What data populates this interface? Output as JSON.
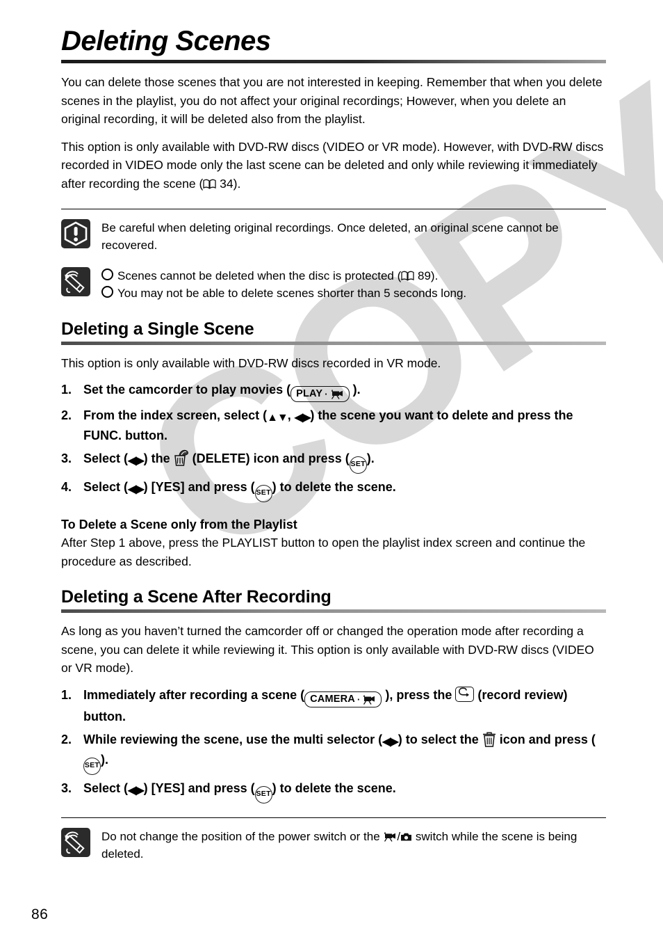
{
  "watermark": {
    "text": "COPY"
  },
  "page": {
    "title": "Deleting Scenes",
    "number": "86"
  },
  "intro": {
    "paragraph_1": "You can delete those scenes that you are not interested in keeping. Remember that when you delete scenes in the playlist, you do not affect your original recordings; However, when you delete an original recording, it will be deleted also from the playlist.",
    "paragraph_2_a": "This option is only available with DVD-RW discs (VIDEO or VR mode). However, with DVD-RW discs recorded in VIDEO mode only the last scene can be deleted and only while reviewing it immediately after recording the scene (",
    "paragraph_2_ref": "34",
    "paragraph_2_b": ")."
  },
  "callouts": {
    "warning": {
      "icon": "warning-exclamation-icon",
      "text": "Be careful when deleting original recordings. Once deleted, an original scene cannot be recovered."
    },
    "notes": {
      "icon": "note-pencil-icon",
      "bullet_1_a": "Scenes cannot be deleted when the disc is protected (",
      "bullet_1_ref": "89",
      "bullet_1_b": ").",
      "bullet_2": "You may not be able to delete scenes shorter than 5 seconds long."
    },
    "footer_note": {
      "icon": "note-pencil-icon",
      "text_a": "Do not change the position of the power switch or the",
      "text_b": "/",
      "text_c": "switch while the scene is being deleted."
    }
  },
  "section_single": {
    "heading": "Deleting a Single Scene",
    "intro": "This option is only available with DVD-RW discs recorded in VR mode.",
    "steps": [
      {
        "num": "1.",
        "text_a": "Set the camcorder to play movies (",
        "badge": "PLAY",
        "text_b": ")."
      },
      {
        "num": "2.",
        "text_a": "From the index screen, select (",
        "arrows_1": "▲▼",
        "text_mid": ",",
        "arrows_2": "◀▶",
        "text_b": ") the scene you want to delete and press the FUNC. button."
      },
      {
        "num": "3.",
        "text_a": "Select (",
        "arrows_1": "◀▶",
        "text_b": ") the",
        "icon": "delete-trash-icon",
        "text_c": "(DELETE) icon and press (",
        "set_label": "SET",
        "text_d": ")."
      },
      {
        "num": "4.",
        "text_a": "Select (",
        "arrows_1": "◀▶",
        "text_b": ") [YES] and press (",
        "set_label": "SET",
        "text_c": ") to delete the scene."
      }
    ],
    "playlist_subhead": "To Delete a Scene only from the Playlist",
    "playlist_body": "After Step 1 above, press the PLAYLIST button to open the playlist index screen and continue the procedure as described."
  },
  "section_after_recording": {
    "heading": "Deleting a Scene After Recording",
    "intro": "As long as you haven’t turned the camcorder off or changed the operation mode after recording a scene, you can delete it while reviewing it. This option is only available with DVD-RW discs (VIDEO or VR mode).",
    "steps": [
      {
        "num": "1.",
        "text_a": "Immediately after recording a scene (",
        "badge": "CAMERA",
        "text_b": "), press the",
        "button_icon": "record-review-button-icon",
        "text_c": "(record review) button."
      },
      {
        "num": "2.",
        "text_a": "While reviewing the scene, use the multi selector (",
        "arrows_1": "◀▶",
        "text_b": ") to select the",
        "icon": "trash-icon",
        "text_c": "icon and press (",
        "set_label": "SET",
        "text_d": ")."
      },
      {
        "num": "3.",
        "text_a": "Select (",
        "arrows_1": "◀▶",
        "text_b": ") [YES] and press (",
        "set_label": "SET",
        "text_c": ") to delete the scene."
      }
    ]
  }
}
